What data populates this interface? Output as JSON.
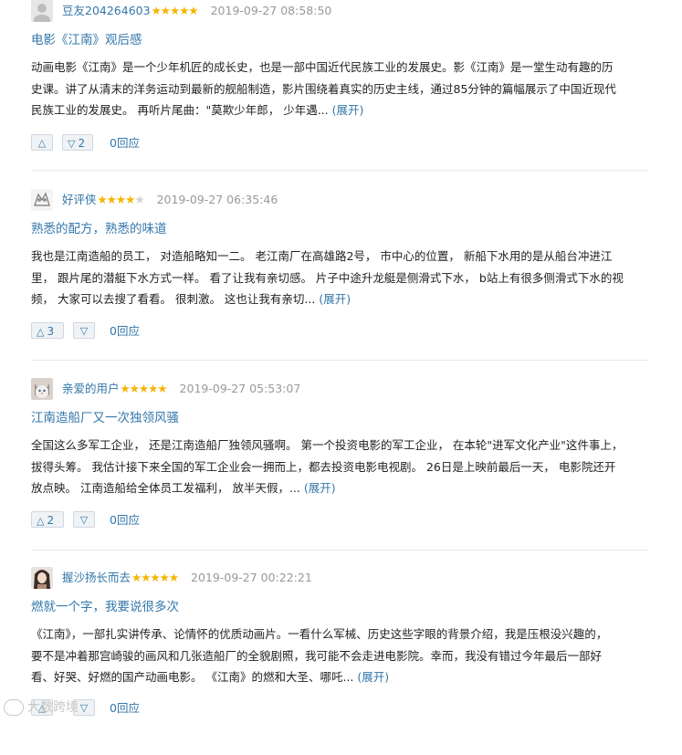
{
  "reviews": [
    {
      "user": "豆友204264603",
      "stars": 5,
      "time": "2019-09-27 08:58:50",
      "title": "电影《江南》观后感",
      "lines": [
        "动画电影《江南》是一个少年机匠的成长史，也是一部中国近代民族工业的发展史。影《江南》是一堂生动有趣的历",
        "史课。讲了从清末的洋务运动到最新的舰船制造，影片围绕着真实的历史主线，通过85分钟的篇幅展示了中国近现代",
        "民族工业的发展史。 再听片尾曲：\"莫欺少年郎， 少年遇..."
      ],
      "expand": "(展开)",
      "up": "",
      "down": "2",
      "reply": "0回应",
      "avatar": "default-avatar"
    },
    {
      "user": "好评侠",
      "stars": 4,
      "time": "2019-09-27 06:35:46",
      "title": "熟悉的配方，熟悉的味道",
      "lines": [
        "我也是江南造船的员工， 对造船略知一二。 老江南厂在高雄路2号， 市中心的位置， 新船下水用的是从船台冲进江",
        "里， 跟片尾的潜艇下水方式一样。 看了让我有亲切感。 片子中途升龙艇是侧滑式下水， b站上有很多侧滑式下水的视",
        "频， 大家可以去搜了看看。 很刺激。 这也让我有亲切... "
      ],
      "expand": "(展开)",
      "up": "3",
      "down": "",
      "reply": "0回应",
      "avatar": "sketch-avatar"
    },
    {
      "user": "亲爱的用户",
      "stars": 5,
      "time": "2019-09-27 05:53:07",
      "title": "江南造船厂又一次独领风骚",
      "lines": [
        "全国这么多军工企业， 还是江南造船厂独领风骚啊。 第一个投资电影的军工企业， 在本轮\"进军文化产业\"这件事上，",
        "拔得头筹。 我估计接下来全国的军工企业会一拥而上，都去投资电影电视剧。 26日是上映前最后一天， 电影院还开",
        "放点映。 江南造船给全体员工发福利， 放半天假，... "
      ],
      "expand": "(展开)",
      "up": "2",
      "down": "",
      "reply": "0回应",
      "avatar": "cat-avatar"
    },
    {
      "user": "握沙扬长而去",
      "stars": 5,
      "time": "2019-09-27 00:22:21",
      "title": "燃就一个字，我要说很多次",
      "lines": [
        "《江南》，一部扎实讲传承、论情怀的优质动画片。一看什么军械、历史这些字眼的背景介绍，我是压根没兴趣的，",
        "要不是冲着那宫崎骏的画风和几张造船厂的全貌剧照，我可能不会走进电影院。幸而，我没有错过今年最后一部好",
        "看、好哭、好燃的国产动画电影。 《江南》的燃和大圣、哪吒... "
      ],
      "expand": "(展开)",
      "up": "",
      "down": "",
      "reply": "0回应",
      "avatar": "girl-avatar"
    }
  ],
  "watermark": "大数跨境"
}
